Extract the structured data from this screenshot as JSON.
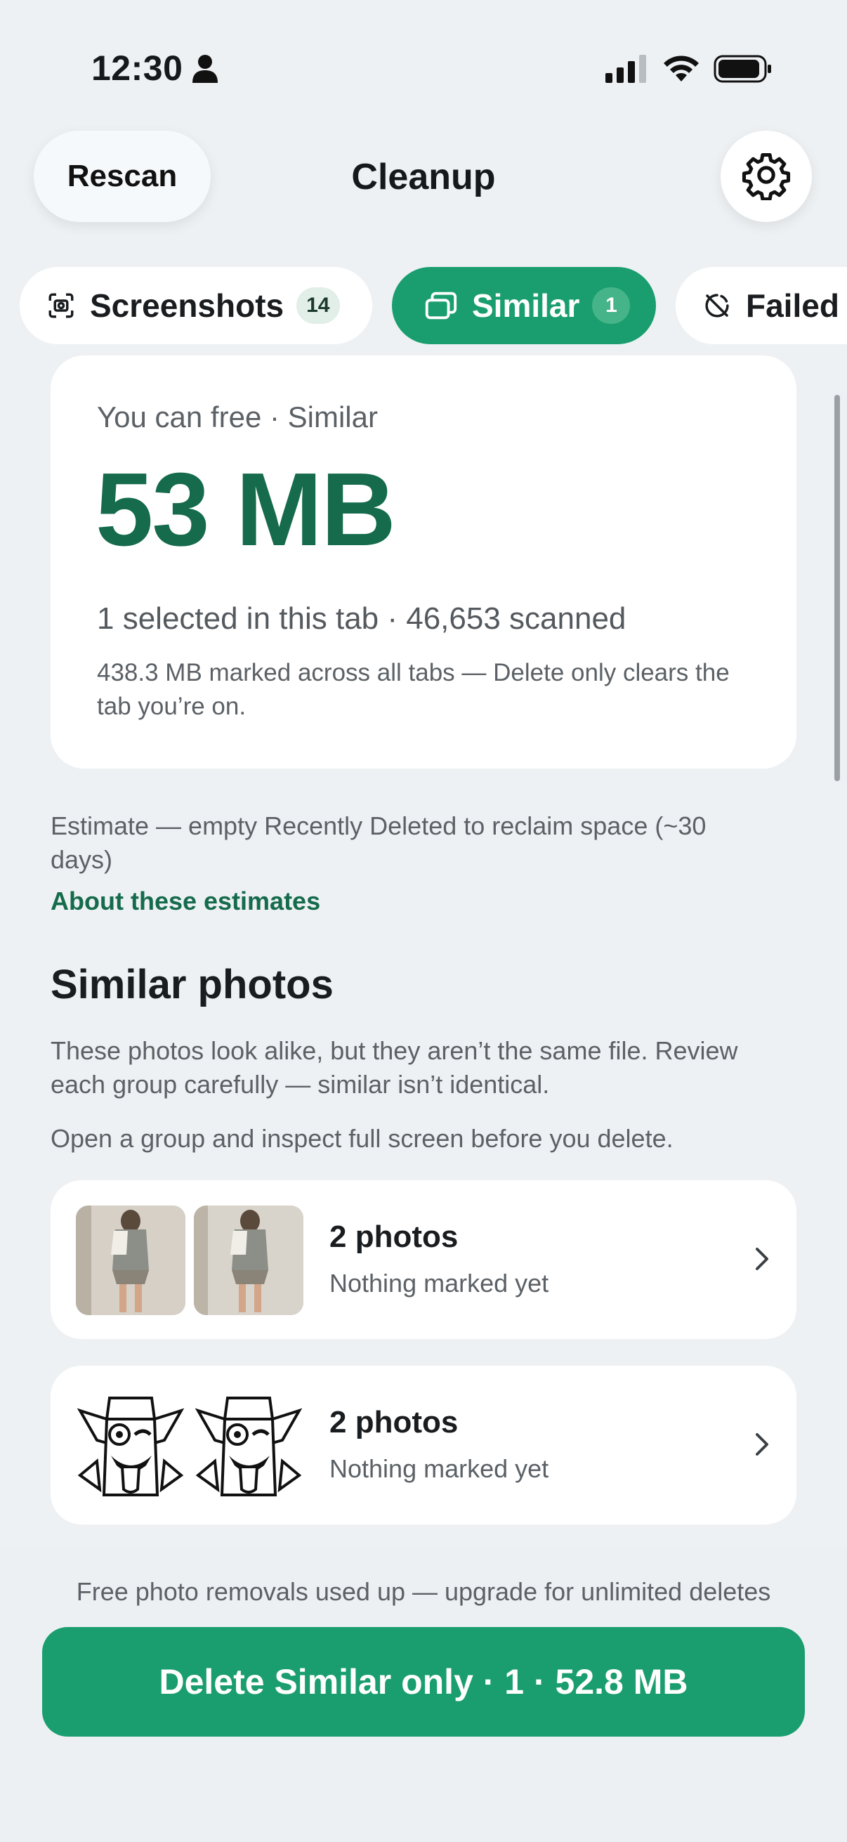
{
  "status_bar": {
    "time": "12:30"
  },
  "header": {
    "rescan_label": "Rescan",
    "title": "Cleanup"
  },
  "tabs": [
    {
      "label": "Screenshots",
      "badge": "14",
      "icon": "screenshot-icon"
    },
    {
      "label": "Similar",
      "badge": "1",
      "icon": "similar-icon"
    },
    {
      "label": "Failed",
      "icon": "failed-icon"
    }
  ],
  "summary": {
    "eyebrow": "You can free · Similar",
    "amount": "53 MB",
    "selected": "1 selected in this tab · 46,653 scanned",
    "note": "438.3 MB marked across all tabs — Delete only clears the tab you’re on."
  },
  "estimate": {
    "text": "Estimate — empty Recently Deleted to reclaim space (~30 days)",
    "link": "About these estimates"
  },
  "section": {
    "title": "Similar photos",
    "description": "These photos look alike, but they aren’t the same file. Review each group carefully — similar isn’t identical.",
    "hint": "Open a group and inspect full screen before you delete."
  },
  "groups": [
    {
      "count": "2 photos",
      "status": "Nothing marked yet"
    },
    {
      "count": "2 photos",
      "status": "Nothing marked yet"
    }
  ],
  "footer": {
    "note": "Free photo removals used up — upgrade for unlimited deletes",
    "delete_label": "Delete Similar only · 1 · 52.8 MB"
  },
  "colors": {
    "accent": "#1a9e6f",
    "accent_dark": "#156b4c",
    "background": "#eef1f3"
  }
}
